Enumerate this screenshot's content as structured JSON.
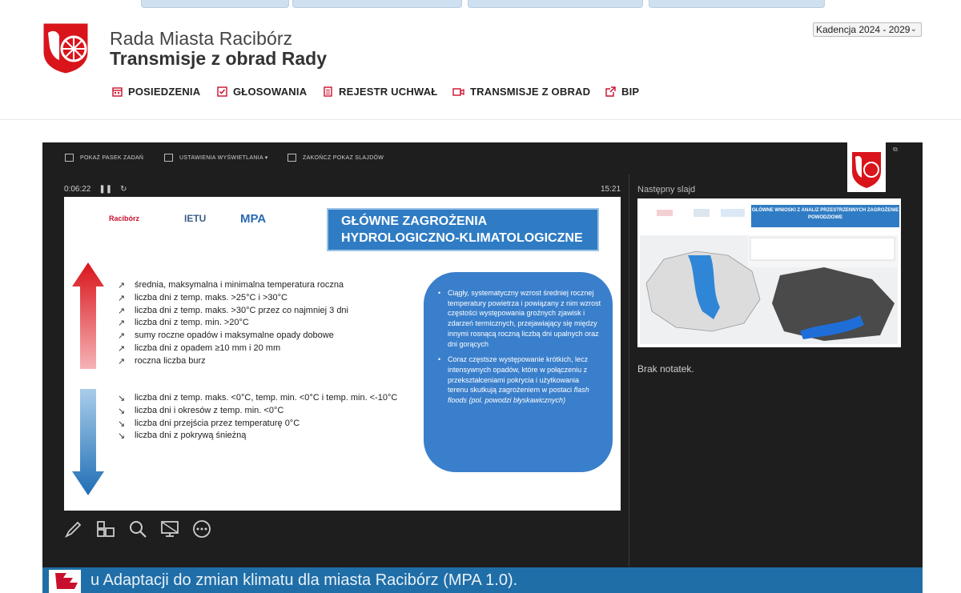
{
  "header": {
    "title": "Rada Miasta Racibórz",
    "subtitle": "Transmisje z obrad Rady",
    "term_select": "Kadencja 2024 - 2029"
  },
  "nav": [
    {
      "label": "POSIEDZENIA",
      "icon": "calendar-icon"
    },
    {
      "label": "GŁOSOWANIA",
      "icon": "checkbox-icon"
    },
    {
      "label": "REJESTR UCHWAŁ",
      "icon": "document-icon"
    },
    {
      "label": "TRANSMISJE Z OBRAD",
      "icon": "video-camera-icon"
    },
    {
      "label": "BIP",
      "icon": "external-link-icon"
    }
  ],
  "colors": {
    "accent": "#c8102e",
    "slide_blue": "#2f7cc4",
    "bar_blue": "#1f6ea8"
  },
  "presenter": {
    "toolbar": [
      "POKAŻ PASEK ZADAŃ",
      "USTAWIENIA WYŚWIETLANIA ▾",
      "ZAKOŃCZ POKAZ SLAJDÓW"
    ],
    "elapsed": "0:06:22",
    "clock": "15:21",
    "next_slide_label": "Następny slajd",
    "notes": "Brak notatek."
  },
  "slide": {
    "logos": [
      "Racibórz",
      "IETU",
      "MPA"
    ],
    "title_line1": "GŁÓWNE ZAGROŻENIA",
    "title_line2": "HYDROLOGICZNO-KLIMATOLOGICZNE",
    "increasing": [
      "średnia, maksymalna i minimalna temperatura roczna",
      " liczba dni z temp. maks. >25°C i >30°C",
      "liczba dni z temp. maks. >30°C przez co najmniej 3 dni",
      "liczba dni z temp. min. >20°C",
      "sumy roczne opadów i maksymalne opady dobowe",
      "liczba dni z opadem ≥10 mm i 20 mm",
      "roczna liczba burz"
    ],
    "decreasing": [
      "liczba dni z temp. maks. <0°C, temp. min. <0°C i temp. min. <-10°C",
      "liczba dni i okresów z temp. min. <0°C",
      "liczba dni przejścia przez temperaturę 0°C",
      "liczba dni z pokrywą śnieżną"
    ],
    "bullet1": "Ciągły, systematyczny wzrost średniej rocznej temperatury powietrza i powiązany z nim wzrost częstości występowania groźnych zjawisk i zdarzeń termicznych, przejawiający się między innymi rosnącą roczną liczbą dni upalnych oraz dni gorących",
    "bullet2_a": "Coraz częstsze występowanie krótkich, lecz intensywnych opadów, które w połączeniu z przekształceniami pokrycia i użytkowania terenu skutkują zagrożeniem w postaci ",
    "bullet2_b": "flash floods (pol. powodzi błyskawicznych)"
  },
  "next_slide": {
    "title": "GŁÓWNE WNIOSKI Z ANALIZ PRZESTRZENNYCH ZAGROŻENIE POWODZIOWE"
  },
  "caption": "u Adaptacji do zmian klimatu dla miasta Racibórz (MPA 1.0)."
}
